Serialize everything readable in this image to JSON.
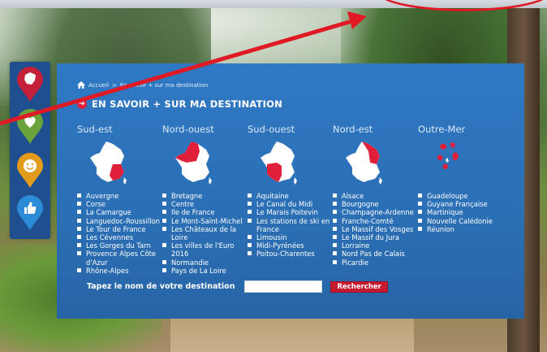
{
  "breadcrumb": {
    "home_label": "Accueil",
    "separator": ">",
    "current": "En savoir + sur ma destination"
  },
  "title": "EN SAVOIR + SUR MA DESTINATION",
  "side_icons": [
    "france-pin-icon",
    "heart-pin-icon",
    "smiley-pin-icon",
    "thumbs-up-pin-icon"
  ],
  "regions": [
    {
      "name": "Sud-est",
      "items": [
        "Auvergne",
        "Corse",
        "La Camargue",
        "Languedoc-Roussillon",
        "Le Tour de France",
        "Les Cévennes",
        "Les Gorges du Tarn",
        "Provence Alpes Côte d'Azur",
        "Rhône-Alpes"
      ]
    },
    {
      "name": "Nord-ouest",
      "items": [
        "Bretagne",
        "Centre",
        "Ile de France",
        "Le Mont-Saint-Michel",
        "Les Châteaux de la Loire",
        "Les villes de l'Euro 2016",
        "Normandie",
        "Pays de La Loire"
      ]
    },
    {
      "name": "Sud-ouest",
      "items": [
        "Aquitaine",
        "Le Canal du Midi",
        "Le Marais Poitevin",
        "Les stations de ski en France",
        "Limousin",
        "Midi-Pyrénées",
        "Poitou-Charentes"
      ]
    },
    {
      "name": "Nord-est",
      "items": [
        "Alsace",
        "Bourgogne",
        "Champagne-Ardenne",
        "Franche-Comté",
        "Le Massif des Vosges",
        "Le Massif du Jura",
        "Lorraine",
        "Nord Pas de Calais",
        "Picardie"
      ]
    },
    {
      "name": "Outre-Mer",
      "items": [
        "Guadeloupe",
        "Guyane Française",
        "Martinique",
        "Nouvelle Calédonie",
        "Réunion"
      ]
    }
  ],
  "search": {
    "label": "Tapez le nom de votre destination",
    "input_value": "",
    "button_label": "Rechercher"
  },
  "colors": {
    "panel": "#2f79c4",
    "accent_red": "#e0203b",
    "side_bar": "#1f4f8f",
    "annotation_red": "#e01a24"
  }
}
